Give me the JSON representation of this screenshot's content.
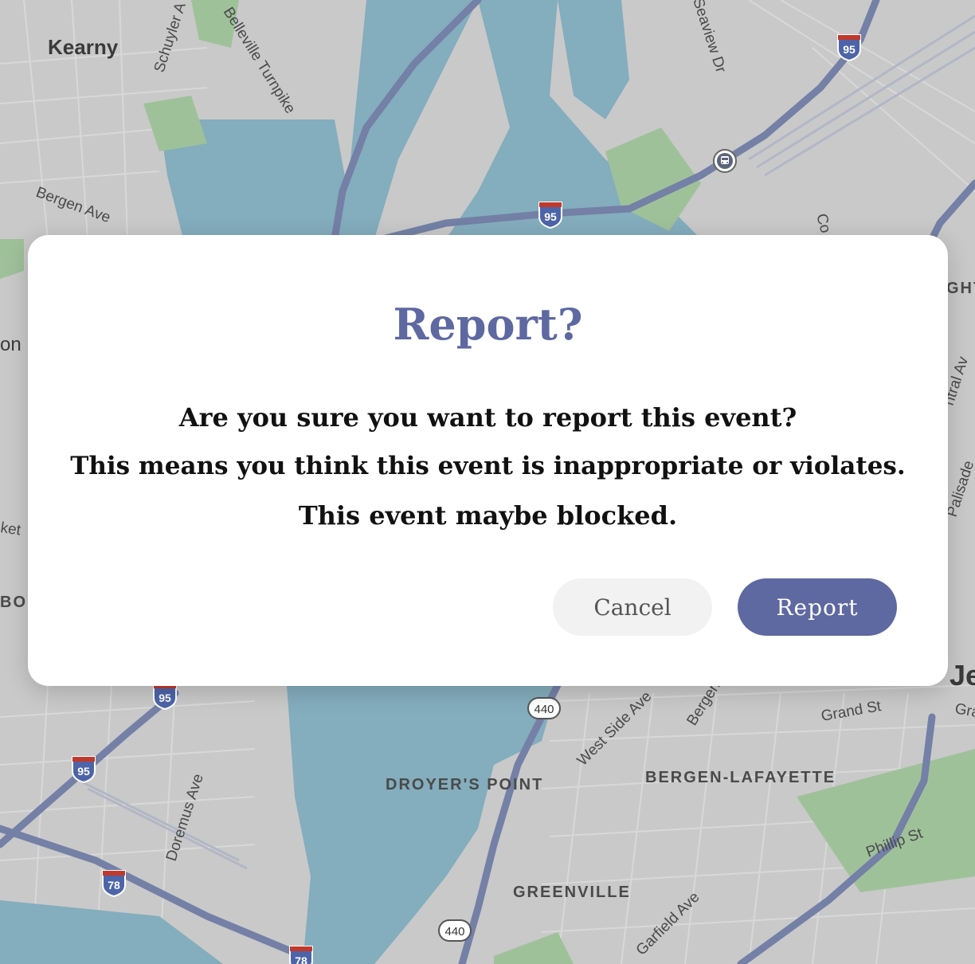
{
  "map": {
    "place_labels": [
      "Kearny",
      "Schuyler A",
      "Belleville Turnpike",
      "Seaview Dr",
      "Bergen Ave",
      "on",
      "ket",
      "BOU",
      "Co",
      "GHT",
      "ntral Av",
      "Palisade",
      "Je",
      "Gra",
      "Grand St",
      "Bergen",
      "West Side Ave",
      "DROYER'S POINT",
      "BERGEN-LAFAYETTE",
      "Doremus Ave",
      "Phillip St",
      "GREENVILLE",
      "Garfield Ave"
    ],
    "interstate_shields": [
      "95",
      "95",
      "95",
      "95",
      "78",
      "78"
    ],
    "route_shields": [
      "440",
      "440"
    ],
    "transit_icon": "train-icon",
    "colors": {
      "land": "#c9c9c9",
      "water": "#84adbd",
      "park": "#9fc19a",
      "highway": "#7480a6",
      "dialog_accent": "#5e68a1"
    }
  },
  "dialog": {
    "title": "Report?",
    "message": [
      "Are you sure you want to report this event?",
      "This means you think this event is inappropriate or violates.",
      "This event maybe blocked."
    ],
    "cancel_label": "Cancel",
    "report_label": "Report"
  }
}
